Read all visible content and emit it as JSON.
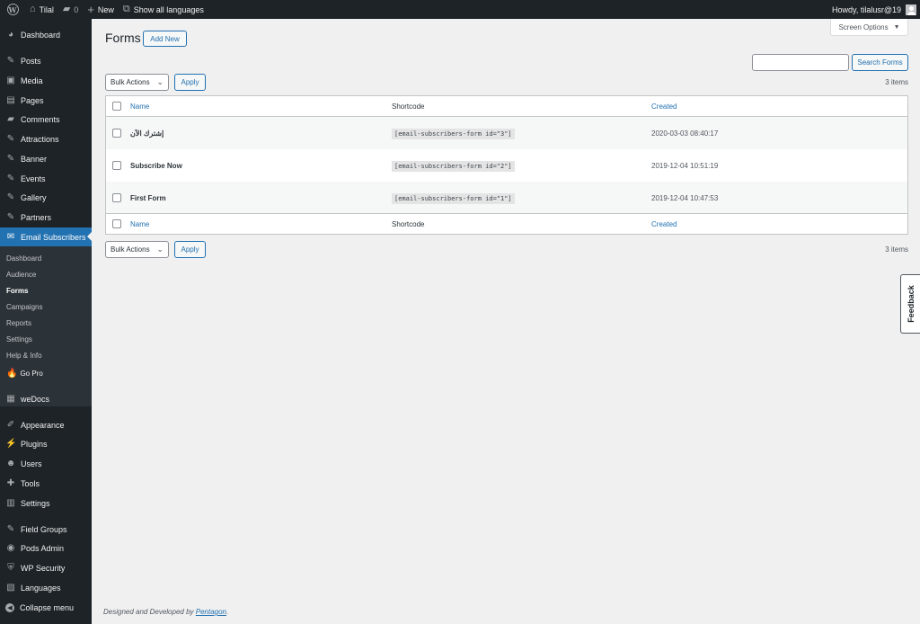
{
  "adminbar": {
    "site_name": "Tilal",
    "comment_count": "0",
    "new_label": "New",
    "languages_label": "Show all languages",
    "howdy": "Howdy, tilalusr@19"
  },
  "menu": {
    "items": [
      {
        "label": "Dashboard",
        "icon": "dashboard-icon",
        "glyph": "◕"
      },
      {
        "label": "Posts",
        "icon": "pin-icon",
        "glyph": "✎"
      },
      {
        "label": "Media",
        "icon": "media-icon",
        "glyph": "▣"
      },
      {
        "label": "Pages",
        "icon": "pages-icon",
        "glyph": "▤"
      },
      {
        "label": "Comments",
        "icon": "comments-icon",
        "glyph": "▰"
      },
      {
        "label": "Attractions",
        "icon": "pin-icon",
        "glyph": "✎"
      },
      {
        "label": "Banner",
        "icon": "pin-icon",
        "glyph": "✎"
      },
      {
        "label": "Events",
        "icon": "pin-icon",
        "glyph": "✎"
      },
      {
        "label": "Gallery",
        "icon": "pin-icon",
        "glyph": "✎"
      },
      {
        "label": "Partners",
        "icon": "pin-icon",
        "glyph": "✎"
      },
      {
        "label": "Email Subscribers",
        "icon": "mail-icon",
        "glyph": "✉"
      },
      {
        "label": "weDocs",
        "icon": "docs-icon",
        "glyph": "▦"
      },
      {
        "label": "Appearance",
        "icon": "brush-icon",
        "glyph": "✐"
      },
      {
        "label": "Plugins",
        "icon": "plugin-icon",
        "glyph": "⚡"
      },
      {
        "label": "Users",
        "icon": "users-icon",
        "glyph": "☻"
      },
      {
        "label": "Tools",
        "icon": "tools-icon",
        "glyph": "✚"
      },
      {
        "label": "Settings",
        "icon": "settings-icon",
        "glyph": "▥"
      },
      {
        "label": "Field Groups",
        "icon": "pin-icon",
        "glyph": "✎"
      },
      {
        "label": "Pods Admin",
        "icon": "pods-icon",
        "glyph": "◉"
      },
      {
        "label": "WP Security",
        "icon": "shield-icon",
        "glyph": "⛨"
      },
      {
        "label": "Languages",
        "icon": "languages-icon",
        "glyph": "▧"
      },
      {
        "label": "Collapse menu",
        "icon": "collapse-icon",
        "glyph": "◀"
      }
    ],
    "submenu": [
      {
        "label": "Dashboard"
      },
      {
        "label": "Audience"
      },
      {
        "label": "Forms"
      },
      {
        "label": "Campaigns"
      },
      {
        "label": "Reports"
      },
      {
        "label": "Settings"
      },
      {
        "label": "Help & Info"
      },
      {
        "label": "Go Pro"
      }
    ]
  },
  "screen_options": "Screen Options",
  "page": {
    "title": "Forms",
    "add_new": "Add New",
    "search_button": "Search Forms",
    "bulk_actions": "Bulk Actions",
    "apply": "Apply",
    "items_count": "3 items"
  },
  "table": {
    "headers": {
      "name": "Name",
      "shortcode": "Shortcode",
      "created": "Created"
    },
    "rows": [
      {
        "name": "إشترك الآن",
        "shortcode": "[email-subscribers-form id=\"3\"]",
        "created": "2020-03-03 08:40:17"
      },
      {
        "name": "Subscribe Now",
        "shortcode": "[email-subscribers-form id=\"2\"]",
        "created": "2019-12-04 10:51:19"
      },
      {
        "name": "First Form",
        "shortcode": "[email-subscribers-form id=\"1\"]",
        "created": "2019-12-04 10:47:53"
      }
    ]
  },
  "feedback": "Feedback",
  "footer": {
    "text": "Designed and Developed by ",
    "link": "Pentagon",
    "suffix": "."
  },
  "colors": {
    "accent": "#2271b1",
    "menu_bg": "#1d2327",
    "submenu_bg": "#2c3338",
    "page_bg": "#f0f0f1"
  }
}
